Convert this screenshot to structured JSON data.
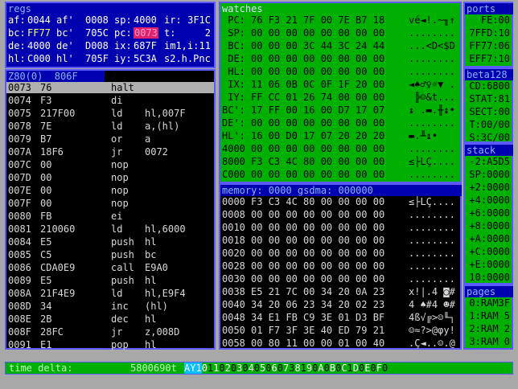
{
  "regs": {
    "title": "regs",
    "rows": [
      [
        "af:",
        "0044",
        "af'",
        "0008",
        "sp:",
        "4000",
        "ir:",
        "3F1C"
      ],
      [
        "bc:",
        "FF77",
        "bc'",
        "705C",
        "pc:",
        "0073",
        "t:",
        "2"
      ],
      [
        "de:",
        "4000",
        "de'",
        "D008",
        "ix:",
        "687F",
        "im1,i:",
        "11"
      ],
      [
        "hl:",
        "C000",
        "hl'",
        "705F",
        "iy:",
        "5C3A",
        "s2.h.Pnc",
        ""
      ]
    ]
  },
  "disasm": {
    "title": "Z80(0)  806F",
    "lines": [
      [
        "0073",
        "76",
        "halt",
        ""
      ],
      [
        "0074",
        "F3",
        "di",
        ""
      ],
      [
        "0075",
        "217F00",
        "ld",
        "hl,007F"
      ],
      [
        "0078",
        "7E",
        "ld",
        "a,(hl)"
      ],
      [
        "0079",
        "B7",
        "or",
        "a"
      ],
      [
        "007A",
        "18F6",
        "jr",
        "0072"
      ],
      [
        "007C",
        "00",
        "nop",
        ""
      ],
      [
        "007D",
        "00",
        "nop",
        ""
      ],
      [
        "007E",
        "00",
        "nop",
        ""
      ],
      [
        "007F",
        "00",
        "nop",
        ""
      ],
      [
        "0080",
        "FB",
        "ei",
        ""
      ],
      [
        "0081",
        "210060",
        "ld",
        "hl,6000"
      ],
      [
        "0084",
        "E5",
        "push",
        "hl"
      ],
      [
        "0085",
        "C5",
        "push",
        "bc"
      ],
      [
        "0086",
        "CDA0E9",
        "call",
        "E9A0"
      ],
      [
        "0089",
        "E5",
        "push",
        "hl"
      ],
      [
        "008A",
        "21F4E9",
        "ld",
        "hl,E9F4"
      ],
      [
        "008D",
        "34",
        "inc",
        "(hl)"
      ],
      [
        "008E",
        "2B",
        "dec",
        "hl"
      ],
      [
        "008F",
        "28FC",
        "jr",
        "z,008D"
      ],
      [
        "0091",
        "E1",
        "pop",
        "hl"
      ]
    ]
  },
  "watches": {
    "title": "watches",
    "rows": [
      [
        " PC:",
        "76 F3 21 7F 00 7E B7 18",
        "vé◄!.~╖↑"
      ],
      [
        " SP:",
        "00 00 00 00 00 00 00 00",
        "........"
      ],
      [
        " BC:",
        "00 00 00 3C 44 3C 24 44",
        "...<D<$D"
      ],
      [
        " DE:",
        "00 00 00 00 00 00 00 00",
        "........"
      ],
      [
        " HL:",
        "00 00 00 00 00 00 00 00",
        "........"
      ],
      [
        " IX:",
        "11 06 0B 0C 0F 1F 20 00",
        "◄♠♂♀☼▼ ."
      ],
      [
        " IY:",
        "FF CC 01 26 74 00 00 00",
        " ╠☺&t..."
      ],
      [
        "BC':",
        "17 FF 00 16 00 D7 17 07",
        "↨ .▬.╫↨•"
      ],
      [
        "DE':",
        "00 00 00 00 00 00 00 00",
        "........"
      ],
      [
        "HL':",
        "16 00 D0 17 07 20 20 20",
        "▬.╨↨•   "
      ],
      [
        "4000",
        "00 00 00 00 00 00 00 00",
        "........"
      ],
      [
        "8000",
        "F3 C3 4C 80 00 00 00 00",
        "≤├LÇ...."
      ],
      [
        "C000",
        "00 00 00 00 00 00 00 00",
        "........"
      ]
    ]
  },
  "memory": {
    "title": "memory: 0000 gsdma: 000000",
    "rows": [
      [
        "0000",
        "F3 C3 4C 80 00 00 00 00",
        "≤├LÇ...."
      ],
      [
        "0008",
        "00 00 00 00 00 00 00 00",
        "........"
      ],
      [
        "0010",
        "00 00 00 00 00 00 00 00",
        "........"
      ],
      [
        "0018",
        "00 00 00 00 00 00 00 00",
        "........"
      ],
      [
        "0020",
        "00 00 00 00 00 00 00 00",
        "........"
      ],
      [
        "0028",
        "00 00 00 00 00 00 00 00",
        "........"
      ],
      [
        "0030",
        "00 00 00 00 00 00 00 00",
        "........"
      ],
      [
        "0038",
        "E5 21 7C 00 34 20 0A 23",
        "x!|.4 ◙#"
      ],
      [
        "0040",
        "34 20 06 23 34 20 02 23",
        "4 ♠#4 ☻#"
      ],
      [
        "0048",
        "34 E1 FB C9 3E 01 D3 BF",
        "4ß√╔>☺╙┐"
      ],
      [
        "0050",
        "01 F7 3F 3E 40 ED 79 21",
        "☺≈?>@φy!"
      ],
      [
        "0058",
        "00 80 11 00 00 01 00 40",
        ".Ç◄..☺.@"
      ]
    ]
  },
  "ports": {
    "title": "ports",
    "rows": [
      "FE:00",
      "7FFD:10",
      "FF77:06",
      "EFF7:10"
    ]
  },
  "beta": {
    "title": "beta128",
    "rows": [
      "CD:6800",
      "STAT:81",
      "SECT:00",
      "T:00/00",
      "S:3C/00"
    ]
  },
  "stack": {
    "title": "stack",
    "rows": [
      "-2:A5D5",
      "SP:0000",
      "+2:0000",
      "+4:0000",
      "+6:0000",
      "+8:0000",
      "+A:0000",
      "+C:0000",
      "+E:0000",
      "10:0000"
    ]
  },
  "pages": {
    "title": "pages",
    "rows": [
      "0:RAM3F",
      "1:RAM 5",
      "2:RAM 2",
      "3:RAM 0"
    ]
  },
  "status": {
    "label": "time delta:",
    "value": "5800690t",
    "function_key": "AY1",
    "keys": [
      [
        "0",
        "1"
      ],
      [
        "1",
        "0"
      ],
      [
        "2",
        "0"
      ],
      [
        "3",
        "0"
      ],
      [
        "4",
        "0"
      ],
      [
        "5",
        "0"
      ],
      [
        "6",
        "0"
      ],
      [
        "7",
        "3"
      ],
      [
        "8",
        "1"
      ],
      [
        "9",
        "0"
      ],
      [
        "A",
        "0"
      ],
      [
        "B",
        "0"
      ],
      [
        "C",
        "1"
      ],
      [
        "D",
        "0"
      ],
      [
        "E",
        "0"
      ],
      [
        "F",
        "0"
      ]
    ]
  },
  "colors": {
    "regs_bg": "#0000b0",
    "watch_bg": "#00b000",
    "mem_bg": "#000000",
    "highlight_pc": "#e0206a",
    "selection": "#b0b0b0",
    "border": "#5a5aff"
  }
}
